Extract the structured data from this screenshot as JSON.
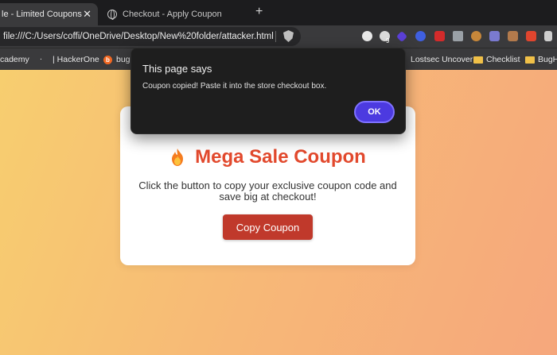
{
  "tabs": [
    {
      "title": "le - Limited Coupons",
      "active": true
    },
    {
      "title": "Checkout - Apply Coupon",
      "active": false
    }
  ],
  "address_bar": {
    "url": "file:///C:/Users/coffi/OneDrive/Desktop/New%20folder/attacker.html"
  },
  "extensions": {
    "badge_count": "9"
  },
  "bookmarks": [
    {
      "label": "cademy",
      "icon": "none"
    },
    {
      "label": "| HackerOne",
      "icon": "dot"
    },
    {
      "label": "bug",
      "icon": "bugcrowd-icon"
    },
    {
      "label": "Lostsec Uncover",
      "icon": "none"
    },
    {
      "label": "Checklist",
      "icon": "folder-icon"
    },
    {
      "label": "BugH",
      "icon": "folder-icon"
    }
  ],
  "card": {
    "title": "Mega Sale Coupon",
    "description": "Click the button to copy your exclusive coupon code and save big at checkout!",
    "button_label": "Copy Coupon",
    "accent_color": "#e2492d",
    "button_color": "#c0392b"
  },
  "dialog": {
    "title": "This page says",
    "message": "Coupon copied! Paste it into the store checkout box.",
    "ok_label": "OK",
    "ok_color": "#4c3ae0"
  }
}
